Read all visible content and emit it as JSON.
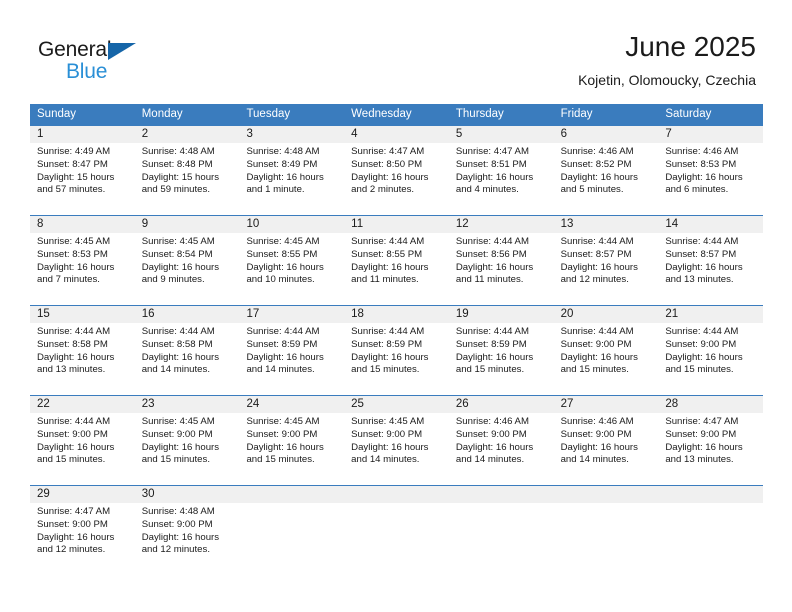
{
  "brand": {
    "name_primary": "General",
    "name_secondary": "Blue",
    "flag_icon": "triangle-flag-icon"
  },
  "header": {
    "title": "June 2025",
    "subtitle": "Kojetin, Olomoucky, Czechia"
  },
  "calendar": {
    "accent_color": "#3a7cbe",
    "daynum_band_color": "#f0f0f0",
    "weekdays": [
      "Sunday",
      "Monday",
      "Tuesday",
      "Wednesday",
      "Thursday",
      "Friday",
      "Saturday"
    ],
    "weeks": [
      [
        {
          "day": "1",
          "sunrise": "Sunrise: 4:49 AM",
          "sunset": "Sunset: 8:47 PM",
          "daylight_1": "Daylight: 15 hours",
          "daylight_2": "and 57 minutes."
        },
        {
          "day": "2",
          "sunrise": "Sunrise: 4:48 AM",
          "sunset": "Sunset: 8:48 PM",
          "daylight_1": "Daylight: 15 hours",
          "daylight_2": "and 59 minutes."
        },
        {
          "day": "3",
          "sunrise": "Sunrise: 4:48 AM",
          "sunset": "Sunset: 8:49 PM",
          "daylight_1": "Daylight: 16 hours",
          "daylight_2": "and 1 minute."
        },
        {
          "day": "4",
          "sunrise": "Sunrise: 4:47 AM",
          "sunset": "Sunset: 8:50 PM",
          "daylight_1": "Daylight: 16 hours",
          "daylight_2": "and 2 minutes."
        },
        {
          "day": "5",
          "sunrise": "Sunrise: 4:47 AM",
          "sunset": "Sunset: 8:51 PM",
          "daylight_1": "Daylight: 16 hours",
          "daylight_2": "and 4 minutes."
        },
        {
          "day": "6",
          "sunrise": "Sunrise: 4:46 AM",
          "sunset": "Sunset: 8:52 PM",
          "daylight_1": "Daylight: 16 hours",
          "daylight_2": "and 5 minutes."
        },
        {
          "day": "7",
          "sunrise": "Sunrise: 4:46 AM",
          "sunset": "Sunset: 8:53 PM",
          "daylight_1": "Daylight: 16 hours",
          "daylight_2": "and 6 minutes."
        }
      ],
      [
        {
          "day": "8",
          "sunrise": "Sunrise: 4:45 AM",
          "sunset": "Sunset: 8:53 PM",
          "daylight_1": "Daylight: 16 hours",
          "daylight_2": "and 7 minutes."
        },
        {
          "day": "9",
          "sunrise": "Sunrise: 4:45 AM",
          "sunset": "Sunset: 8:54 PM",
          "daylight_1": "Daylight: 16 hours",
          "daylight_2": "and 9 minutes."
        },
        {
          "day": "10",
          "sunrise": "Sunrise: 4:45 AM",
          "sunset": "Sunset: 8:55 PM",
          "daylight_1": "Daylight: 16 hours",
          "daylight_2": "and 10 minutes."
        },
        {
          "day": "11",
          "sunrise": "Sunrise: 4:44 AM",
          "sunset": "Sunset: 8:55 PM",
          "daylight_1": "Daylight: 16 hours",
          "daylight_2": "and 11 minutes."
        },
        {
          "day": "12",
          "sunrise": "Sunrise: 4:44 AM",
          "sunset": "Sunset: 8:56 PM",
          "daylight_1": "Daylight: 16 hours",
          "daylight_2": "and 11 minutes."
        },
        {
          "day": "13",
          "sunrise": "Sunrise: 4:44 AM",
          "sunset": "Sunset: 8:57 PM",
          "daylight_1": "Daylight: 16 hours",
          "daylight_2": "and 12 minutes."
        },
        {
          "day": "14",
          "sunrise": "Sunrise: 4:44 AM",
          "sunset": "Sunset: 8:57 PM",
          "daylight_1": "Daylight: 16 hours",
          "daylight_2": "and 13 minutes."
        }
      ],
      [
        {
          "day": "15",
          "sunrise": "Sunrise: 4:44 AM",
          "sunset": "Sunset: 8:58 PM",
          "daylight_1": "Daylight: 16 hours",
          "daylight_2": "and 13 minutes."
        },
        {
          "day": "16",
          "sunrise": "Sunrise: 4:44 AM",
          "sunset": "Sunset: 8:58 PM",
          "daylight_1": "Daylight: 16 hours",
          "daylight_2": "and 14 minutes."
        },
        {
          "day": "17",
          "sunrise": "Sunrise: 4:44 AM",
          "sunset": "Sunset: 8:59 PM",
          "daylight_1": "Daylight: 16 hours",
          "daylight_2": "and 14 minutes."
        },
        {
          "day": "18",
          "sunrise": "Sunrise: 4:44 AM",
          "sunset": "Sunset: 8:59 PM",
          "daylight_1": "Daylight: 16 hours",
          "daylight_2": "and 15 minutes."
        },
        {
          "day": "19",
          "sunrise": "Sunrise: 4:44 AM",
          "sunset": "Sunset: 8:59 PM",
          "daylight_1": "Daylight: 16 hours",
          "daylight_2": "and 15 minutes."
        },
        {
          "day": "20",
          "sunrise": "Sunrise: 4:44 AM",
          "sunset": "Sunset: 9:00 PM",
          "daylight_1": "Daylight: 16 hours",
          "daylight_2": "and 15 minutes."
        },
        {
          "day": "21",
          "sunrise": "Sunrise: 4:44 AM",
          "sunset": "Sunset: 9:00 PM",
          "daylight_1": "Daylight: 16 hours",
          "daylight_2": "and 15 minutes."
        }
      ],
      [
        {
          "day": "22",
          "sunrise": "Sunrise: 4:44 AM",
          "sunset": "Sunset: 9:00 PM",
          "daylight_1": "Daylight: 16 hours",
          "daylight_2": "and 15 minutes."
        },
        {
          "day": "23",
          "sunrise": "Sunrise: 4:45 AM",
          "sunset": "Sunset: 9:00 PM",
          "daylight_1": "Daylight: 16 hours",
          "daylight_2": "and 15 minutes."
        },
        {
          "day": "24",
          "sunrise": "Sunrise: 4:45 AM",
          "sunset": "Sunset: 9:00 PM",
          "daylight_1": "Daylight: 16 hours",
          "daylight_2": "and 15 minutes."
        },
        {
          "day": "25",
          "sunrise": "Sunrise: 4:45 AM",
          "sunset": "Sunset: 9:00 PM",
          "daylight_1": "Daylight: 16 hours",
          "daylight_2": "and 14 minutes."
        },
        {
          "day": "26",
          "sunrise": "Sunrise: 4:46 AM",
          "sunset": "Sunset: 9:00 PM",
          "daylight_1": "Daylight: 16 hours",
          "daylight_2": "and 14 minutes."
        },
        {
          "day": "27",
          "sunrise": "Sunrise: 4:46 AM",
          "sunset": "Sunset: 9:00 PM",
          "daylight_1": "Daylight: 16 hours",
          "daylight_2": "and 14 minutes."
        },
        {
          "day": "28",
          "sunrise": "Sunrise: 4:47 AM",
          "sunset": "Sunset: 9:00 PM",
          "daylight_1": "Daylight: 16 hours",
          "daylight_2": "and 13 minutes."
        }
      ],
      [
        {
          "day": "29",
          "sunrise": "Sunrise: 4:47 AM",
          "sunset": "Sunset: 9:00 PM",
          "daylight_1": "Daylight: 16 hours",
          "daylight_2": "and 12 minutes."
        },
        {
          "day": "30",
          "sunrise": "Sunrise: 4:48 AM",
          "sunset": "Sunset: 9:00 PM",
          "daylight_1": "Daylight: 16 hours",
          "daylight_2": "and 12 minutes."
        },
        {
          "day": "",
          "sunrise": "",
          "sunset": "",
          "daylight_1": "",
          "daylight_2": ""
        },
        {
          "day": "",
          "sunrise": "",
          "sunset": "",
          "daylight_1": "",
          "daylight_2": ""
        },
        {
          "day": "",
          "sunrise": "",
          "sunset": "",
          "daylight_1": "",
          "daylight_2": ""
        },
        {
          "day": "",
          "sunrise": "",
          "sunset": "",
          "daylight_1": "",
          "daylight_2": ""
        },
        {
          "day": "",
          "sunrise": "",
          "sunset": "",
          "daylight_1": "",
          "daylight_2": ""
        }
      ]
    ]
  }
}
